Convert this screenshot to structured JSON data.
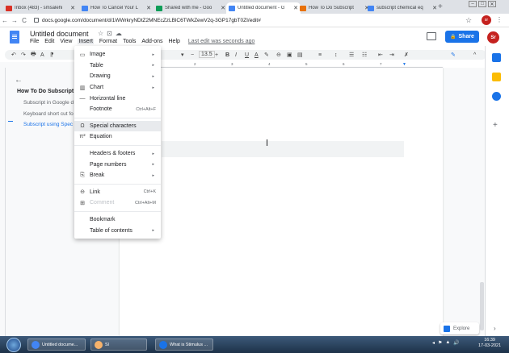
{
  "browser": {
    "tabs": [
      {
        "title": "Inbox (483) - smsalehi",
        "color": "#d93025",
        "active": false
      },
      {
        "title": "How To Cancel Your L",
        "color": "#4285f4",
        "active": false
      },
      {
        "title": "Shared with me - Goo",
        "color": "#0f9d58",
        "active": false
      },
      {
        "title": "Untitled document - G",
        "color": "#4285f4",
        "active": true
      },
      {
        "title": "How To Do Subscript",
        "color": "#e8710a",
        "active": false
      },
      {
        "title": "subscript chemical eq",
        "color": "#4285f4",
        "active": false
      }
    ],
    "tab_close": "✕",
    "new_tab": "+",
    "url": "docs.google.com/document/d/1WWrkryNDtZ2MNEcZzLBlC6TWkZewV2q-3GP17gbT0ZI/edit#",
    "back": "←",
    "forward": "→",
    "reload": "C",
    "profile": "sr",
    "kebab": "⋮"
  },
  "docs": {
    "title": "Untitled document",
    "title_icons": [
      "☆",
      "⊡",
      "☁"
    ],
    "menus": [
      "File",
      "Edit",
      "View",
      "Insert",
      "Format",
      "Tools",
      "Add-ons",
      "Help"
    ],
    "last_edit": "Last edit was seconds ago",
    "share_label": "Share",
    "share_icon": "🔒",
    "avatar": "Sr",
    "toolbar": {
      "left_icons": [
        "↶",
        "↷",
        "🖶",
        "A",
        "⁋"
      ],
      "font_size": "13.5",
      "minus": "−",
      "plus": "+",
      "format": [
        "B",
        "I",
        "U",
        "A",
        "✎"
      ],
      "insert": [
        "⊖",
        "▣",
        "▤"
      ],
      "align": [
        "≡",
        "↕",
        "☰",
        "☷",
        "⇤",
        "⇥",
        "✗"
      ],
      "edit_mode": "✎",
      "collapse": "^"
    },
    "ruler_marks": [
      "1",
      "2",
      "3",
      "4",
      "5",
      "6",
      "7"
    ]
  },
  "outline": {
    "back": "←",
    "title": "How To Do Subscript",
    "items": [
      "Subscript in Google d",
      "Keyboard short cut fo",
      "Subscript using Spec"
    ]
  },
  "insert_menu": {
    "items": [
      {
        "icon": "▭",
        "label": "Image",
        "shortcut": "",
        "arrow": "▸",
        "enabled": true,
        "hover": false
      },
      {
        "icon": "",
        "label": "Table",
        "shortcut": "",
        "arrow": "▸",
        "enabled": true,
        "hover": false
      },
      {
        "icon": "",
        "label": "Drawing",
        "shortcut": "",
        "arrow": "▸",
        "enabled": true,
        "hover": false
      },
      {
        "icon": "▥",
        "label": "Chart",
        "shortcut": "",
        "arrow": "▸",
        "enabled": true,
        "hover": false
      },
      {
        "icon": "—",
        "label": "Horizontal line",
        "shortcut": "",
        "arrow": "",
        "enabled": true,
        "hover": false
      },
      {
        "icon": "",
        "label": "Footnote",
        "shortcut": "Ctrl+Alt+F",
        "arrow": "",
        "enabled": true,
        "hover": false
      },
      {
        "sep": true
      },
      {
        "icon": "Ω",
        "label": "Special characters",
        "shortcut": "",
        "arrow": "",
        "enabled": true,
        "hover": true
      },
      {
        "icon": "π²",
        "label": "Equation",
        "shortcut": "",
        "arrow": "",
        "enabled": true,
        "hover": false
      },
      {
        "sep": true
      },
      {
        "icon": "",
        "label": "Headers & footers",
        "shortcut": "",
        "arrow": "▸",
        "enabled": true,
        "hover": false
      },
      {
        "icon": "",
        "label": "Page numbers",
        "shortcut": "",
        "arrow": "▸",
        "enabled": true,
        "hover": false
      },
      {
        "icon": "⎘",
        "label": "Break",
        "shortcut": "",
        "arrow": "▸",
        "enabled": true,
        "hover": false
      },
      {
        "sep": true
      },
      {
        "icon": "⊖",
        "label": "Link",
        "shortcut": "Ctrl+K",
        "arrow": "",
        "enabled": true,
        "hover": false
      },
      {
        "icon": "⊞",
        "label": "Comment",
        "shortcut": "Ctrl+Alt+M",
        "arrow": "",
        "enabled": false,
        "hover": false
      },
      {
        "sep": true
      },
      {
        "icon": "",
        "label": "Bookmark",
        "shortcut": "",
        "arrow": "",
        "enabled": true,
        "hover": false
      },
      {
        "icon": "",
        "label": "Table of contents",
        "shortcut": "",
        "arrow": "▸",
        "enabled": true,
        "hover": false
      }
    ]
  },
  "side_panel": {
    "plus": "+",
    "icon_colors": [
      "#1a73e8",
      "#fbbc04",
      "#1a73e8"
    ],
    "explore_label": "Explore",
    "expand": "›"
  },
  "taskbar": {
    "items": [
      {
        "label": "Untitled docume...",
        "color": "#4285f4"
      },
      {
        "label": "Sl",
        "color": "#f6b26b"
      },
      {
        "label": "",
        "color": "#1a73e8"
      },
      {
        "label": "What is Stimulus ...",
        "color": "#1a73e8"
      }
    ],
    "tray": [
      "◂",
      "⚑",
      "▲",
      "🔊"
    ],
    "time": "16:39",
    "date": "17-03-2021"
  }
}
